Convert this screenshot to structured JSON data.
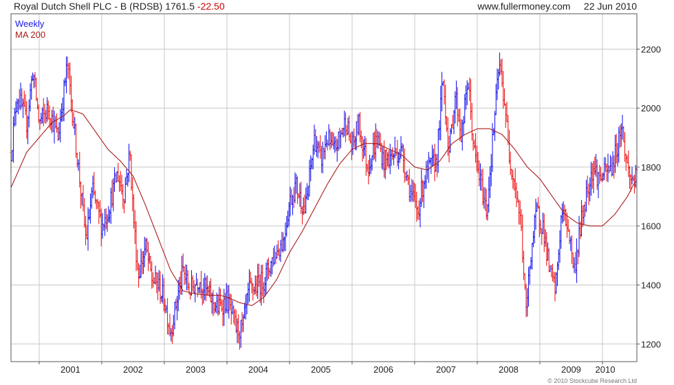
{
  "header": {
    "title": "Royal Dutch Shell PLC - B (RDSB)",
    "last_price": "1761.5",
    "change": "-22.50",
    "source": "www.fullermoney.com",
    "date": "22 Jun 2010"
  },
  "legend": {
    "series1": "Weekly",
    "series2": "MA 200"
  },
  "credit": "© 2010 Stockcube Research Ltd",
  "colors": {
    "up": "#1a1aee",
    "down": "#ee1a1a",
    "ma": "#aa1a1a",
    "grid": "#c8c8c8",
    "axis": "#555555"
  },
  "chart_data": {
    "type": "line",
    "title": "Royal Dutch Shell PLC - B (RDSB)",
    "x_tick_labels": [
      "2001",
      "2002",
      "2003",
      "2004",
      "2005",
      "2006",
      "2007",
      "2008",
      "2009",
      "2010"
    ],
    "y_tick_labels": [
      "1200",
      "1400",
      "1600",
      "1800",
      "2000",
      "2200"
    ],
    "ylim": [
      1140,
      2320
    ],
    "xlim": [
      2000.55,
      2010.55
    ],
    "grid": true,
    "legend_position": "top-left",
    "series": [
      {
        "name": "Weekly",
        "kind": "price_bars",
        "up_color": "#1a1aee",
        "down_color": "#ee1a1a",
        "anchors": [
          [
            2000.55,
            1850
          ],
          [
            2000.65,
            2050
          ],
          [
            2000.8,
            1950
          ],
          [
            2000.9,
            2130
          ],
          [
            2001.0,
            1950
          ],
          [
            2001.15,
            2000
          ],
          [
            2001.3,
            1900
          ],
          [
            2001.45,
            2150
          ],
          [
            2001.55,
            1950
          ],
          [
            2001.65,
            1750
          ],
          [
            2001.75,
            1550
          ],
          [
            2001.85,
            1720
          ],
          [
            2002.0,
            1600
          ],
          [
            2002.1,
            1650
          ],
          [
            2002.25,
            1780
          ],
          [
            2002.35,
            1700
          ],
          [
            2002.45,
            1850
          ],
          [
            2002.5,
            1650
          ],
          [
            2002.58,
            1430
          ],
          [
            2002.7,
            1530
          ],
          [
            2002.8,
            1420
          ],
          [
            2002.9,
            1400
          ],
          [
            2003.0,
            1350
          ],
          [
            2003.1,
            1240
          ],
          [
            2003.2,
            1350
          ],
          [
            2003.3,
            1450
          ],
          [
            2003.4,
            1380
          ],
          [
            2003.55,
            1420
          ],
          [
            2003.7,
            1370
          ],
          [
            2003.85,
            1320
          ],
          [
            2004.0,
            1350
          ],
          [
            2004.15,
            1250
          ],
          [
            2004.25,
            1250
          ],
          [
            2004.35,
            1380
          ],
          [
            2004.5,
            1400
          ],
          [
            2004.6,
            1420
          ],
          [
            2004.75,
            1500
          ],
          [
            2004.9,
            1550
          ],
          [
            2005.0,
            1680
          ],
          [
            2005.1,
            1740
          ],
          [
            2005.25,
            1650
          ],
          [
            2005.4,
            1900
          ],
          [
            2005.5,
            1820
          ],
          [
            2005.6,
            1900
          ],
          [
            2005.7,
            1850
          ],
          [
            2005.8,
            1900
          ],
          [
            2005.9,
            1960
          ],
          [
            2006.0,
            1860
          ],
          [
            2006.1,
            1950
          ],
          [
            2006.25,
            1800
          ],
          [
            2006.4,
            1900
          ],
          [
            2006.5,
            1820
          ],
          [
            2006.6,
            1830
          ],
          [
            2006.7,
            1850
          ],
          [
            2006.8,
            1850
          ],
          [
            2006.95,
            1700
          ],
          [
            2007.05,
            1650
          ],
          [
            2007.15,
            1760
          ],
          [
            2007.25,
            1800
          ],
          [
            2007.35,
            1820
          ],
          [
            2007.45,
            2100
          ],
          [
            2007.55,
            1850
          ],
          [
            2007.65,
            2050
          ],
          [
            2007.75,
            1900
          ],
          [
            2007.85,
            2100
          ],
          [
            2007.95,
            1850
          ],
          [
            2008.05,
            1750
          ],
          [
            2008.15,
            1650
          ],
          [
            2008.25,
            1900
          ],
          [
            2008.35,
            2150
          ],
          [
            2008.45,
            2000
          ],
          [
            2008.5,
            1850
          ],
          [
            2008.6,
            1750
          ],
          [
            2008.7,
            1600
          ],
          [
            2008.78,
            1300
          ],
          [
            2008.85,
            1500
          ],
          [
            2008.95,
            1650
          ],
          [
            2009.05,
            1600
          ],
          [
            2009.15,
            1450
          ],
          [
            2009.25,
            1380
          ],
          [
            2009.35,
            1650
          ],
          [
            2009.45,
            1600
          ],
          [
            2009.55,
            1450
          ],
          [
            2009.65,
            1600
          ],
          [
            2009.75,
            1720
          ],
          [
            2009.85,
            1800
          ],
          [
            2009.95,
            1760
          ],
          [
            2010.05,
            1780
          ],
          [
            2010.15,
            1800
          ],
          [
            2010.25,
            1880
          ],
          [
            2010.3,
            1950
          ],
          [
            2010.38,
            1820
          ],
          [
            2010.45,
            1760
          ],
          [
            2010.52,
            1760
          ]
        ]
      },
      {
        "name": "MA 200",
        "kind": "line",
        "color": "#aa1a1a",
        "anchors": [
          [
            2000.55,
            1730
          ],
          [
            2000.8,
            1850
          ],
          [
            2001.0,
            1900
          ],
          [
            2001.2,
            1950
          ],
          [
            2001.4,
            1975
          ],
          [
            2001.5,
            1995
          ],
          [
            2001.7,
            1980
          ],
          [
            2001.9,
            1920
          ],
          [
            2002.1,
            1860
          ],
          [
            2002.3,
            1820
          ],
          [
            2002.5,
            1770
          ],
          [
            2002.7,
            1670
          ],
          [
            2002.9,
            1560
          ],
          [
            2003.1,
            1450
          ],
          [
            2003.3,
            1380
          ],
          [
            2003.5,
            1370
          ],
          [
            2003.7,
            1365
          ],
          [
            2003.9,
            1365
          ],
          [
            2004.1,
            1350
          ],
          [
            2004.2,
            1340
          ],
          [
            2004.4,
            1330
          ],
          [
            2004.6,
            1360
          ],
          [
            2004.8,
            1420
          ],
          [
            2005.0,
            1510
          ],
          [
            2005.2,
            1580
          ],
          [
            2005.4,
            1660
          ],
          [
            2005.6,
            1740
          ],
          [
            2005.8,
            1810
          ],
          [
            2006.0,
            1860
          ],
          [
            2006.2,
            1880
          ],
          [
            2006.4,
            1880
          ],
          [
            2006.6,
            1860
          ],
          [
            2006.8,
            1840
          ],
          [
            2007.0,
            1800
          ],
          [
            2007.2,
            1790
          ],
          [
            2007.4,
            1820
          ],
          [
            2007.6,
            1880
          ],
          [
            2007.8,
            1910
          ],
          [
            2008.0,
            1930
          ],
          [
            2008.2,
            1930
          ],
          [
            2008.4,
            1910
          ],
          [
            2008.6,
            1860
          ],
          [
            2008.8,
            1800
          ],
          [
            2009.0,
            1760
          ],
          [
            2009.2,
            1700
          ],
          [
            2009.4,
            1640
          ],
          [
            2009.6,
            1610
          ],
          [
            2009.8,
            1600
          ],
          [
            2010.0,
            1600
          ],
          [
            2010.2,
            1640
          ],
          [
            2010.4,
            1700
          ],
          [
            2010.52,
            1750
          ]
        ]
      }
    ]
  }
}
